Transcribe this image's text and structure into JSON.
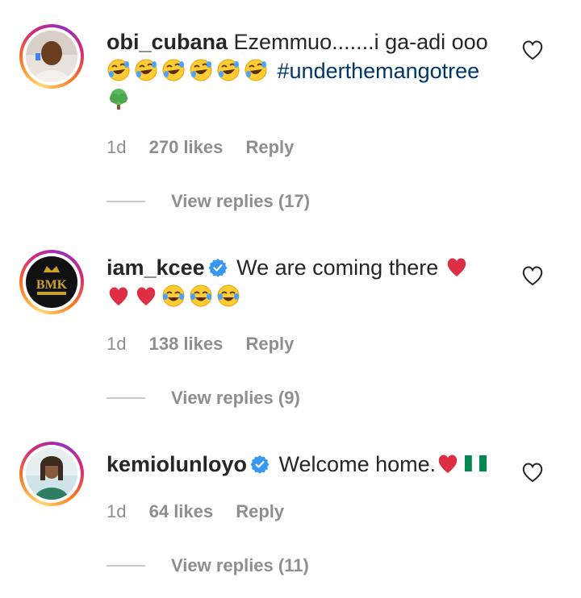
{
  "comments": [
    {
      "username": "obi_cubana",
      "verified": false,
      "text": "Ezemmuo.......i ga-adi ooo",
      "emoji_line": "🤣🤣🤣🤣🤣🤣",
      "hashtag": "#underthemangotree",
      "emoji_tail": "🌳",
      "time": "1d",
      "likes": "270 likes",
      "reply_label": "Reply",
      "view_replies": "View replies (17)"
    },
    {
      "username": "iam_kcee",
      "verified": true,
      "text": "We are coming there",
      "emoji_after_text": "❤️",
      "emoji_line": "❤️❤️😂😂😂",
      "time": "1d",
      "likes": "138 likes",
      "reply_label": "Reply",
      "view_replies": "View replies (9)"
    },
    {
      "username": "kemiolunloyo",
      "verified": true,
      "text": "Welcome home.",
      "emoji_after_text": "❤️🇳🇬",
      "time": "1d",
      "likes": "64 likes",
      "reply_label": "Reply",
      "view_replies": "View replies (11)"
    }
  ],
  "colors": {
    "text": "#262626",
    "muted": "#8e8e8e",
    "hashtag": "#00376b",
    "verified": "#3897f0"
  }
}
